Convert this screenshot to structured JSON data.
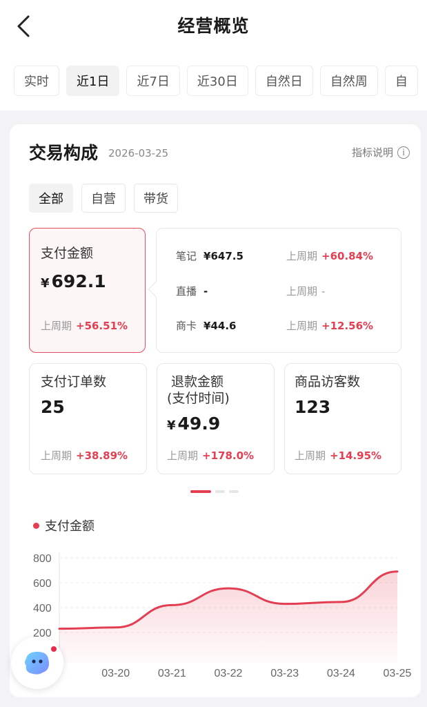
{
  "header": {
    "title": "经营概览"
  },
  "tabs": [
    "实时",
    "近1日",
    "近7日",
    "近30日",
    "自然日",
    "自然周",
    "自"
  ],
  "card": {
    "title": "交易构成",
    "date": "2026-03-25",
    "help": "指标说明",
    "filters": [
      "全部",
      "自营",
      "带货"
    ]
  },
  "pay_amount": {
    "label": "支付金额",
    "currency": "¥",
    "value": "692.1",
    "prev_label": "上周期",
    "change": "+56.51%"
  },
  "breakdown": [
    {
      "label": "笔记",
      "value": "¥647.5",
      "prev_label": "上周期",
      "change": "+60.84%"
    },
    {
      "label": "直播",
      "value": "-",
      "prev_label": "上周期",
      "change": "-"
    },
    {
      "label": "商卡",
      "value": "¥44.6",
      "prev_label": "上周期",
      "change": "+12.56%"
    }
  ],
  "orders": {
    "label": "支付订单数",
    "value": "25",
    "prev_label": "上周期",
    "change": "+38.89%"
  },
  "refund": {
    "label_line1": "退款金额",
    "label_line2": "(支付时间)",
    "currency": "¥",
    "value": "49.9",
    "prev_label": "上周期",
    "change": "+178.0%"
  },
  "visitors": {
    "label": "商品访客数",
    "value": "123",
    "prev_label": "上周期",
    "change": "+14.95%"
  },
  "chart_legend": "支付金额",
  "colors": {
    "accent": "#e33e52",
    "selected_bg": "#fdf6f6"
  },
  "chart_data": {
    "type": "area",
    "series": [
      {
        "name": "支付金额",
        "values": [
          230,
          240,
          420,
          555,
          430,
          445,
          690
        ]
      }
    ],
    "x": [
      "",
      "03-20",
      "03-21",
      "03-22",
      "03-23",
      "03-24",
      "03-25"
    ],
    "xtick_labels": [
      "03-20",
      "03-21",
      "03-22",
      "03-23",
      "03-24",
      "03-25"
    ],
    "ytick_labels": [
      "800",
      "600",
      "400",
      "200"
    ],
    "ylim": [
      0,
      800
    ]
  }
}
